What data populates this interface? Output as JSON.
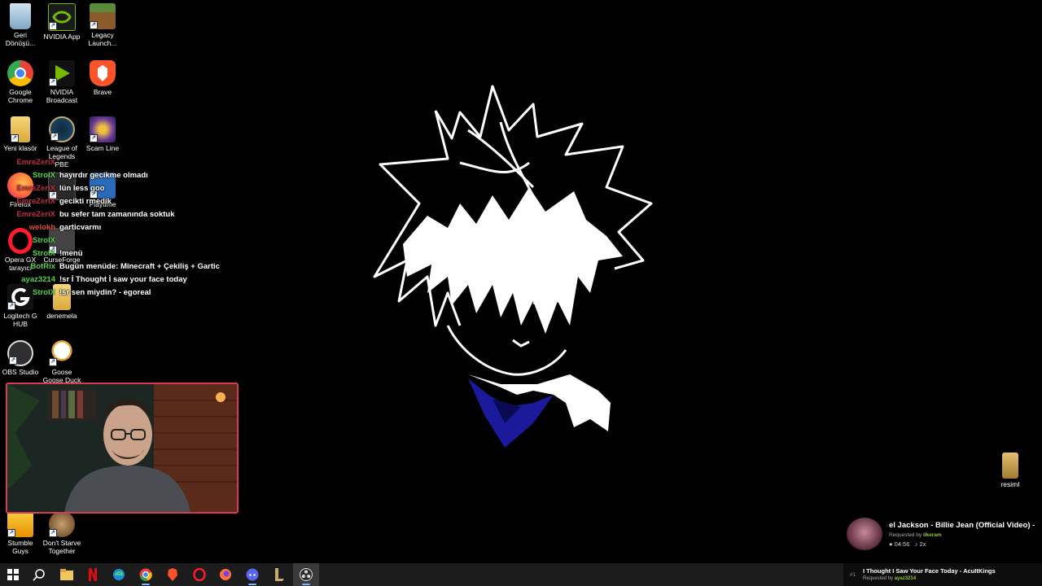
{
  "desktop_icons": [
    {
      "name": "recycle-bin-icon",
      "label": "Geri Dönüşü...",
      "color": "#8fb8d8"
    },
    {
      "name": "nvidia-app-icon",
      "label": "NVIDIA App",
      "color": "#76b900"
    },
    {
      "name": "legacy-launcher-icon",
      "label": "Legacy Launch...",
      "color": "#5b8a3a"
    },
    {
      "name": "chrome-icon",
      "label": "Google Chrome",
      "color": "#e8453c"
    },
    {
      "name": "nvidia-broadcast-icon",
      "label": "NVIDIA Broadcast",
      "color": "#76b900"
    },
    {
      "name": "brave-icon",
      "label": "Brave",
      "color": "#fb542b"
    },
    {
      "name": "folder-icon",
      "label": "Yeni klasör",
      "color": "#f0c75e"
    },
    {
      "name": "league-pbe-icon",
      "label": "League of Legends PBE",
      "color": "#1e4a6e"
    },
    {
      "name": "scam-line-icon",
      "label": "Scam Line",
      "color": "#6a3a9a"
    },
    {
      "name": "firefox-icon",
      "label": "Firefox",
      "color": "#ff7139"
    },
    {
      "name": "glow-icon",
      "label": "",
      "color": "#3a3a3a"
    },
    {
      "name": "playtime-icon",
      "label": "Playtime",
      "color": "#2a6ab8"
    },
    {
      "name": "opera-gx-icon",
      "label": "Opera GX tarayıcı",
      "color": "#ff1b2d"
    },
    {
      "name": "curseforge-icon",
      "label": "CurseForge",
      "color": "#555555"
    },
    {
      "name": "logitech-icon",
      "label": "Logitech G HUB",
      "color": "#ffffff"
    },
    {
      "name": "denemela-icon",
      "label": "denemela",
      "color": "#f0c75e"
    },
    {
      "name": "obs-icon",
      "label": "OBS Studio",
      "color": "#302e31"
    },
    {
      "name": "goose-icon",
      "label": "Goose Goose Duck",
      "color": "#eeeeee"
    },
    {
      "name": "stumble-guys-icon",
      "label": "Stumble Guys",
      "color": "#f0b400"
    },
    {
      "name": "dont-starve-icon",
      "label": "Don't Starve Together",
      "color": "#8a6a3a"
    },
    {
      "name": "resim-icon",
      "label": "resimI",
      "color": "#c9a14a"
    }
  ],
  "chat": [
    {
      "user": "EmreZeriX",
      "user_color": "#c03046",
      "text": ""
    },
    {
      "user": "StroIX",
      "user_color": "#58d24a",
      "text": "hayırdır gecikme olmadı"
    },
    {
      "user": "EmreZeriX",
      "user_color": "#c03046",
      "text": "lün less goo"
    },
    {
      "user": "EmreZeriX",
      "user_color": "#c03046",
      "text": "gecikti rmedik"
    },
    {
      "user": "EmreZeriX",
      "user_color": "#c03046",
      "text": "bu sefer tam zamanında soktuk"
    },
    {
      "user": "welokh",
      "user_color": "#e04a3a",
      "text": "garticvarmı"
    },
    {
      "user": "StroIX",
      "user_color": "#58d24a",
      "text": ""
    },
    {
      "user": "StroIX",
      "user_color": "#58d24a",
      "text": "!menü"
    },
    {
      "user": "BotRix",
      "user_color": "#58d24a",
      "text": "Bugün menüde: Minecraft + Çekiliş + Gartic"
    },
    {
      "user": "ayaz3214",
      "user_color": "#58d24a",
      "text": "!sr İ Thought İ saw your face today"
    },
    {
      "user": "StroIX",
      "user_color": "#58d24a",
      "text": "!sr sen miydin? - egoreal"
    }
  ],
  "now_playing": {
    "title": "el Jackson - Billie Jean (Official Video) -",
    "requested_by_label": "Requested by",
    "requested_by": "ilkeram",
    "time": "04:56",
    "plays": "2x"
  },
  "queue": {
    "index": "#1",
    "title": "I Thought I Saw Your Face Today - AcuItKings",
    "requested_by_label": "Requested by",
    "requested_by": "ayaz3214"
  },
  "taskbar": [
    {
      "name": "start-button",
      "icon": "windows-icon"
    },
    {
      "name": "search-button",
      "icon": "search-icon"
    },
    {
      "name": "taskbar-file-explorer",
      "icon": "folder-icon"
    },
    {
      "name": "taskbar-netflix",
      "icon": "netflix-icon"
    },
    {
      "name": "taskbar-edge",
      "icon": "edge-icon"
    },
    {
      "name": "taskbar-chrome",
      "icon": "chrome-icon"
    },
    {
      "name": "taskbar-brave",
      "icon": "brave-icon"
    },
    {
      "name": "taskbar-opera",
      "icon": "opera-icon"
    },
    {
      "name": "taskbar-firefox",
      "icon": "firefox-icon"
    },
    {
      "name": "taskbar-discord",
      "icon": "discord-icon"
    },
    {
      "name": "taskbar-league",
      "icon": "league-icon"
    },
    {
      "name": "taskbar-obs",
      "icon": "obs-icon"
    }
  ]
}
